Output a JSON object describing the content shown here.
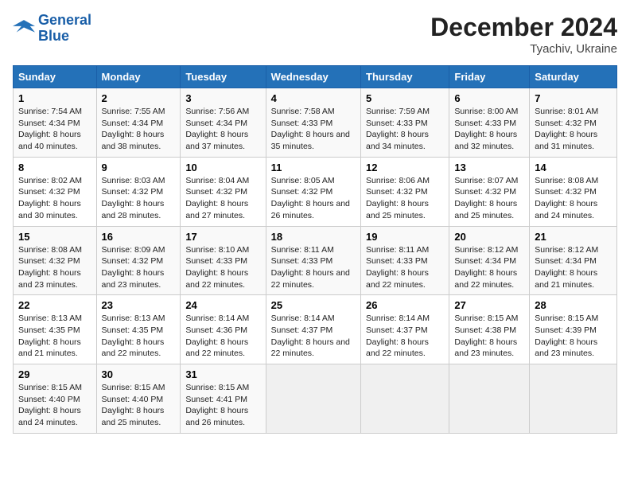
{
  "logo": {
    "line1": "General",
    "line2": "Blue"
  },
  "title": "December 2024",
  "location": "Tyachiv, Ukraine",
  "headers": [
    "Sunday",
    "Monday",
    "Tuesday",
    "Wednesday",
    "Thursday",
    "Friday",
    "Saturday"
  ],
  "weeks": [
    [
      {
        "day": "1",
        "sunrise": "Sunrise: 7:54 AM",
        "sunset": "Sunset: 4:34 PM",
        "daylight": "Daylight: 8 hours and 40 minutes."
      },
      {
        "day": "2",
        "sunrise": "Sunrise: 7:55 AM",
        "sunset": "Sunset: 4:34 PM",
        "daylight": "Daylight: 8 hours and 38 minutes."
      },
      {
        "day": "3",
        "sunrise": "Sunrise: 7:56 AM",
        "sunset": "Sunset: 4:34 PM",
        "daylight": "Daylight: 8 hours and 37 minutes."
      },
      {
        "day": "4",
        "sunrise": "Sunrise: 7:58 AM",
        "sunset": "Sunset: 4:33 PM",
        "daylight": "Daylight: 8 hours and 35 minutes."
      },
      {
        "day": "5",
        "sunrise": "Sunrise: 7:59 AM",
        "sunset": "Sunset: 4:33 PM",
        "daylight": "Daylight: 8 hours and 34 minutes."
      },
      {
        "day": "6",
        "sunrise": "Sunrise: 8:00 AM",
        "sunset": "Sunset: 4:33 PM",
        "daylight": "Daylight: 8 hours and 32 minutes."
      },
      {
        "day": "7",
        "sunrise": "Sunrise: 8:01 AM",
        "sunset": "Sunset: 4:32 PM",
        "daylight": "Daylight: 8 hours and 31 minutes."
      }
    ],
    [
      {
        "day": "8",
        "sunrise": "Sunrise: 8:02 AM",
        "sunset": "Sunset: 4:32 PM",
        "daylight": "Daylight: 8 hours and 30 minutes."
      },
      {
        "day": "9",
        "sunrise": "Sunrise: 8:03 AM",
        "sunset": "Sunset: 4:32 PM",
        "daylight": "Daylight: 8 hours and 28 minutes."
      },
      {
        "day": "10",
        "sunrise": "Sunrise: 8:04 AM",
        "sunset": "Sunset: 4:32 PM",
        "daylight": "Daylight: 8 hours and 27 minutes."
      },
      {
        "day": "11",
        "sunrise": "Sunrise: 8:05 AM",
        "sunset": "Sunset: 4:32 PM",
        "daylight": "Daylight: 8 hours and 26 minutes."
      },
      {
        "day": "12",
        "sunrise": "Sunrise: 8:06 AM",
        "sunset": "Sunset: 4:32 PM",
        "daylight": "Daylight: 8 hours and 25 minutes."
      },
      {
        "day": "13",
        "sunrise": "Sunrise: 8:07 AM",
        "sunset": "Sunset: 4:32 PM",
        "daylight": "Daylight: 8 hours and 25 minutes."
      },
      {
        "day": "14",
        "sunrise": "Sunrise: 8:08 AM",
        "sunset": "Sunset: 4:32 PM",
        "daylight": "Daylight: 8 hours and 24 minutes."
      }
    ],
    [
      {
        "day": "15",
        "sunrise": "Sunrise: 8:08 AM",
        "sunset": "Sunset: 4:32 PM",
        "daylight": "Daylight: 8 hours and 23 minutes."
      },
      {
        "day": "16",
        "sunrise": "Sunrise: 8:09 AM",
        "sunset": "Sunset: 4:32 PM",
        "daylight": "Daylight: 8 hours and 23 minutes."
      },
      {
        "day": "17",
        "sunrise": "Sunrise: 8:10 AM",
        "sunset": "Sunset: 4:33 PM",
        "daylight": "Daylight: 8 hours and 22 minutes."
      },
      {
        "day": "18",
        "sunrise": "Sunrise: 8:11 AM",
        "sunset": "Sunset: 4:33 PM",
        "daylight": "Daylight: 8 hours and 22 minutes."
      },
      {
        "day": "19",
        "sunrise": "Sunrise: 8:11 AM",
        "sunset": "Sunset: 4:33 PM",
        "daylight": "Daylight: 8 hours and 22 minutes."
      },
      {
        "day": "20",
        "sunrise": "Sunrise: 8:12 AM",
        "sunset": "Sunset: 4:34 PM",
        "daylight": "Daylight: 8 hours and 22 minutes."
      },
      {
        "day": "21",
        "sunrise": "Sunrise: 8:12 AM",
        "sunset": "Sunset: 4:34 PM",
        "daylight": "Daylight: 8 hours and 21 minutes."
      }
    ],
    [
      {
        "day": "22",
        "sunrise": "Sunrise: 8:13 AM",
        "sunset": "Sunset: 4:35 PM",
        "daylight": "Daylight: 8 hours and 21 minutes."
      },
      {
        "day": "23",
        "sunrise": "Sunrise: 8:13 AM",
        "sunset": "Sunset: 4:35 PM",
        "daylight": "Daylight: 8 hours and 22 minutes."
      },
      {
        "day": "24",
        "sunrise": "Sunrise: 8:14 AM",
        "sunset": "Sunset: 4:36 PM",
        "daylight": "Daylight: 8 hours and 22 minutes."
      },
      {
        "day": "25",
        "sunrise": "Sunrise: 8:14 AM",
        "sunset": "Sunset: 4:37 PM",
        "daylight": "Daylight: 8 hours and 22 minutes."
      },
      {
        "day": "26",
        "sunrise": "Sunrise: 8:14 AM",
        "sunset": "Sunset: 4:37 PM",
        "daylight": "Daylight: 8 hours and 22 minutes."
      },
      {
        "day": "27",
        "sunrise": "Sunrise: 8:15 AM",
        "sunset": "Sunset: 4:38 PM",
        "daylight": "Daylight: 8 hours and 23 minutes."
      },
      {
        "day": "28",
        "sunrise": "Sunrise: 8:15 AM",
        "sunset": "Sunset: 4:39 PM",
        "daylight": "Daylight: 8 hours and 23 minutes."
      }
    ],
    [
      {
        "day": "29",
        "sunrise": "Sunrise: 8:15 AM",
        "sunset": "Sunset: 4:40 PM",
        "daylight": "Daylight: 8 hours and 24 minutes."
      },
      {
        "day": "30",
        "sunrise": "Sunrise: 8:15 AM",
        "sunset": "Sunset: 4:40 PM",
        "daylight": "Daylight: 8 hours and 25 minutes."
      },
      {
        "day": "31",
        "sunrise": "Sunrise: 8:15 AM",
        "sunset": "Sunset: 4:41 PM",
        "daylight": "Daylight: 8 hours and 26 minutes."
      },
      null,
      null,
      null,
      null
    ]
  ]
}
